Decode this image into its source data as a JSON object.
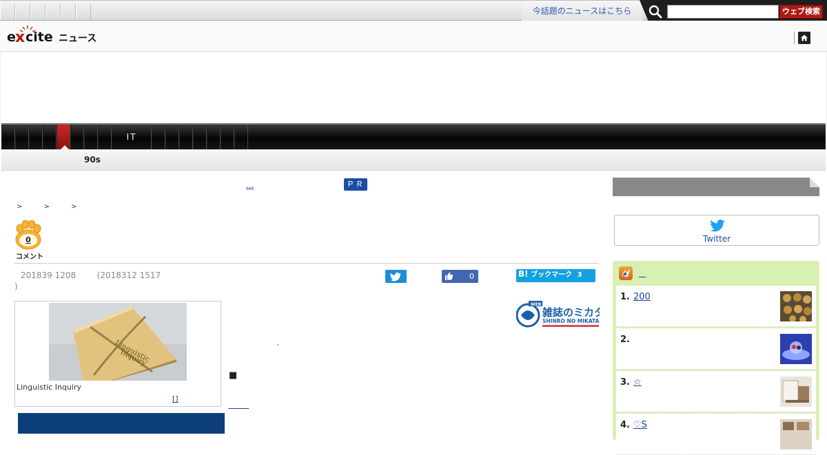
{
  "topbar": {
    "tab_count": 6,
    "news_link": "今話題のニュースはこちら",
    "search_placeholder": "",
    "search_button": "ウェブ検索"
  },
  "header": {
    "logo_text": "excite",
    "logo_suffix": "ニュース"
  },
  "nav": {
    "categories": [
      "",
      "",
      "",
      "",
      "",
      "",
      "",
      "",
      "IT",
      "",
      "",
      "",
      "",
      "",
      "",
      "",
      "",
      ""
    ],
    "active_index": 4
  },
  "subnav": {
    "title": "90s"
  },
  "article": {
    "pr_link": "...",
    "pr_badge": "ＰＲ",
    "breadcrumb": "> > >",
    "comment_count": "0",
    "comment_label": "コメント",
    "date_published": "201839 1208",
    "date_updated": "(2018312 1517",
    "date_close": ")",
    "like_count": "0",
    "hatena_label": "ブックマーク",
    "hatena_count": "3",
    "photo_caption": "Linguistic Inquiry",
    "photo_book_title": "Linguistic\nInquiry",
    "photo_link": "[]",
    "source_name": "雑誌のミカタ",
    "source_name_en": "SHINRO NO MIKATA",
    "body_dot": ",",
    "body_square": "■"
  },
  "sidebar": {
    "twitter_label": "Twitter",
    "ranking": [
      {
        "num": "1.",
        "title": "200"
      },
      {
        "num": "2.",
        "title": ""
      },
      {
        "num": "3.",
        "title": "☆"
      },
      {
        "num": "4.",
        "title": "♡S"
      }
    ]
  },
  "colors": {
    "accent_red": "#c72b26",
    "link_blue": "#1a3fa8",
    "ranking_bg": "#d9f0b3",
    "twitter_blue": "#1d8dd8",
    "facebook_blue": "#4267b2",
    "hatena_blue": "#12a1e0"
  }
}
